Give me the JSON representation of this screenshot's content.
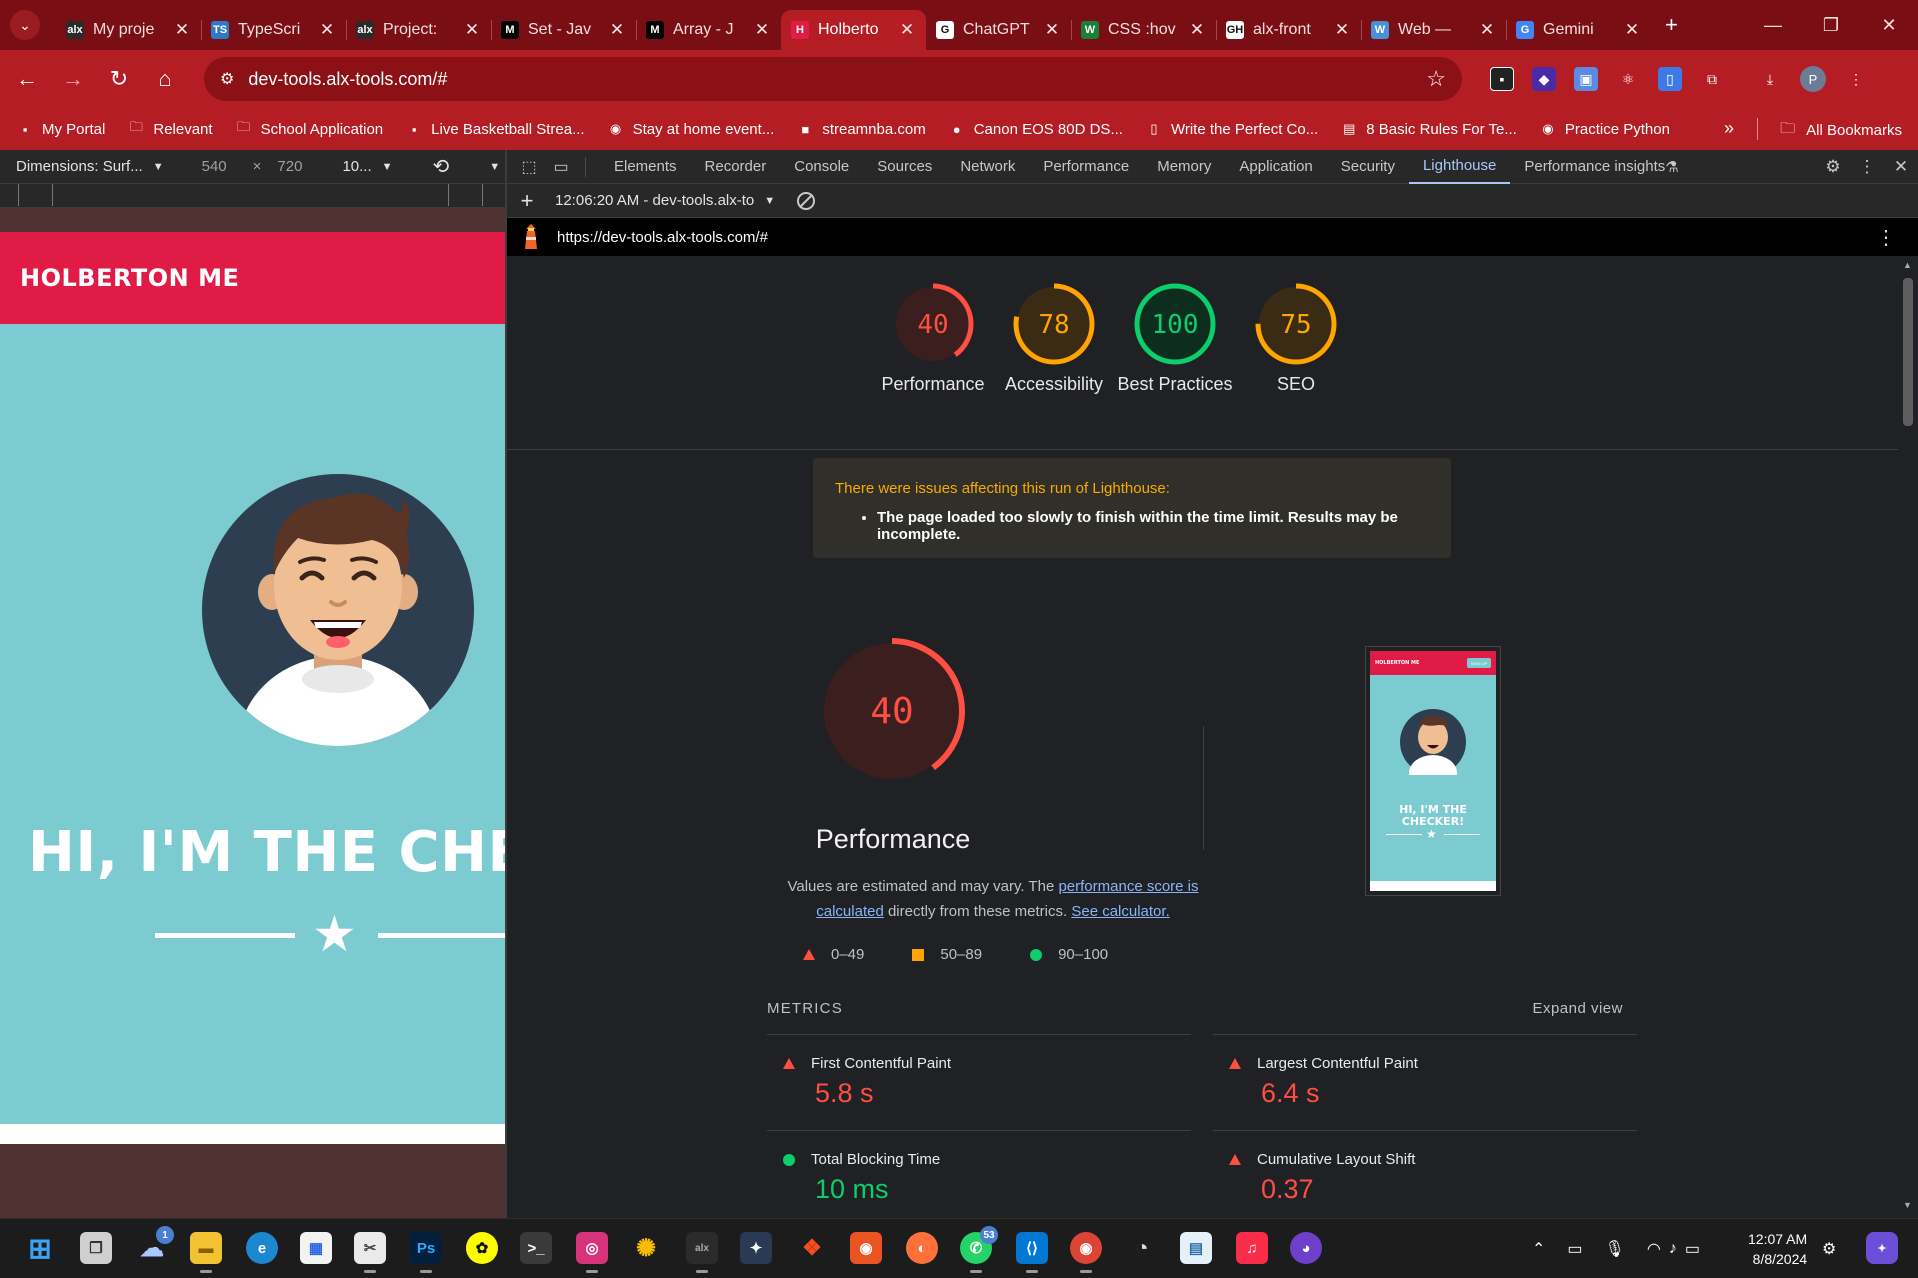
{
  "browser": {
    "tabs": [
      {
        "title": "My proje",
        "favicon": "alx",
        "color": "#2b2b2b"
      },
      {
        "title": "TypeScri",
        "favicon": "TS",
        "color": "#3178c6"
      },
      {
        "title": "Project: ",
        "favicon": "alx",
        "color": "#2b2b2b"
      },
      {
        "title": "Set - Jav",
        "favicon": "M",
        "color": "#000000"
      },
      {
        "title": "Array - J",
        "favicon": "M",
        "color": "#000000"
      },
      {
        "title": "Holberto",
        "favicon": "H",
        "color": "#e01b45"
      },
      {
        "title": "ChatGPT",
        "favicon": "G",
        "color": "#ffffff"
      },
      {
        "title": "CSS :hov",
        "favicon": "W",
        "color": "#1a7f37"
      },
      {
        "title": "alx-front",
        "favicon": "GH",
        "color": "#ffffff"
      },
      {
        "title": "Web — ",
        "favicon": "W",
        "color": "#4a90d9"
      },
      {
        "title": "Gemini",
        "favicon": "G",
        "color": "#4285f4"
      }
    ],
    "url": "dev-tools.alx-tools.com/#",
    "profile_initial": "P",
    "bookmarks": [
      "My Portal",
      "Relevant",
      "School Application",
      "Live Basketball Strea...",
      "Stay at home event...",
      "streamnba.com",
      "Canon EOS 80D DS...",
      "Write the Perfect Co...",
      "8 Basic Rules For Te...",
      "Practice Python"
    ],
    "all_bookmarks": "All Bookmarks"
  },
  "device": {
    "dimensions": "Dimensions: Surf...",
    "width": "540",
    "height": "720",
    "zoom": "10..."
  },
  "site": {
    "brand": "HOLBERTON ME",
    "hero_title": "HI, I'M THE CHECKER!",
    "thumb_button": "SIGN UP"
  },
  "devtools": {
    "tabs": [
      "Elements",
      "Recorder",
      "Console",
      "Sources",
      "Network",
      "Performance",
      "Memory",
      "Application",
      "Security",
      "Lighthouse",
      "Performance insights"
    ],
    "active_tab": "Lighthouse",
    "run_label": "12:06:20 AM - dev-tools.alx-to",
    "report_url": "https://dev-tools.alx-tools.com/#"
  },
  "lighthouse": {
    "scores": [
      {
        "label": "Performance",
        "score": 40
      },
      {
        "label": "Accessibility",
        "score": 78
      },
      {
        "label": "Best Practices",
        "score": 100
      },
      {
        "label": "SEO",
        "score": 75
      }
    ],
    "warning_title": "There were issues affecting this run of Lighthouse:",
    "warning_item": "The page loaded too slowly to finish within the time limit. Results may be incomplete.",
    "perf_title": "Performance",
    "perf_desc_1": "Values are estimated and may vary. The ",
    "perf_link_1": "performance score is calculated",
    "perf_desc_2": " directly from these metrics. ",
    "perf_link_2": "See calculator.",
    "legend": [
      "0–49",
      "50–89",
      "90–100"
    ],
    "metrics_heading": "METRICS",
    "expand_view": "Expand view",
    "metrics": [
      {
        "name": "First Contentful Paint",
        "value": "5.8 s",
        "rating": "fail"
      },
      {
        "name": "Largest Contentful Paint",
        "value": "6.4 s",
        "rating": "fail"
      },
      {
        "name": "Total Blocking Time",
        "value": "10 ms",
        "rating": "pass"
      },
      {
        "name": "Cumulative Layout Shift",
        "value": "0.37",
        "rating": "fail"
      }
    ]
  },
  "colors": {
    "fail": "#ff4e42",
    "average": "#ffa400",
    "pass": "#0cce6b",
    "chrome": "#b51d25"
  },
  "taskbar": {
    "badges": {
      "weather": "1",
      "whatsapp": "53"
    },
    "time": "12:07 AM",
    "date": "8/8/2024"
  }
}
